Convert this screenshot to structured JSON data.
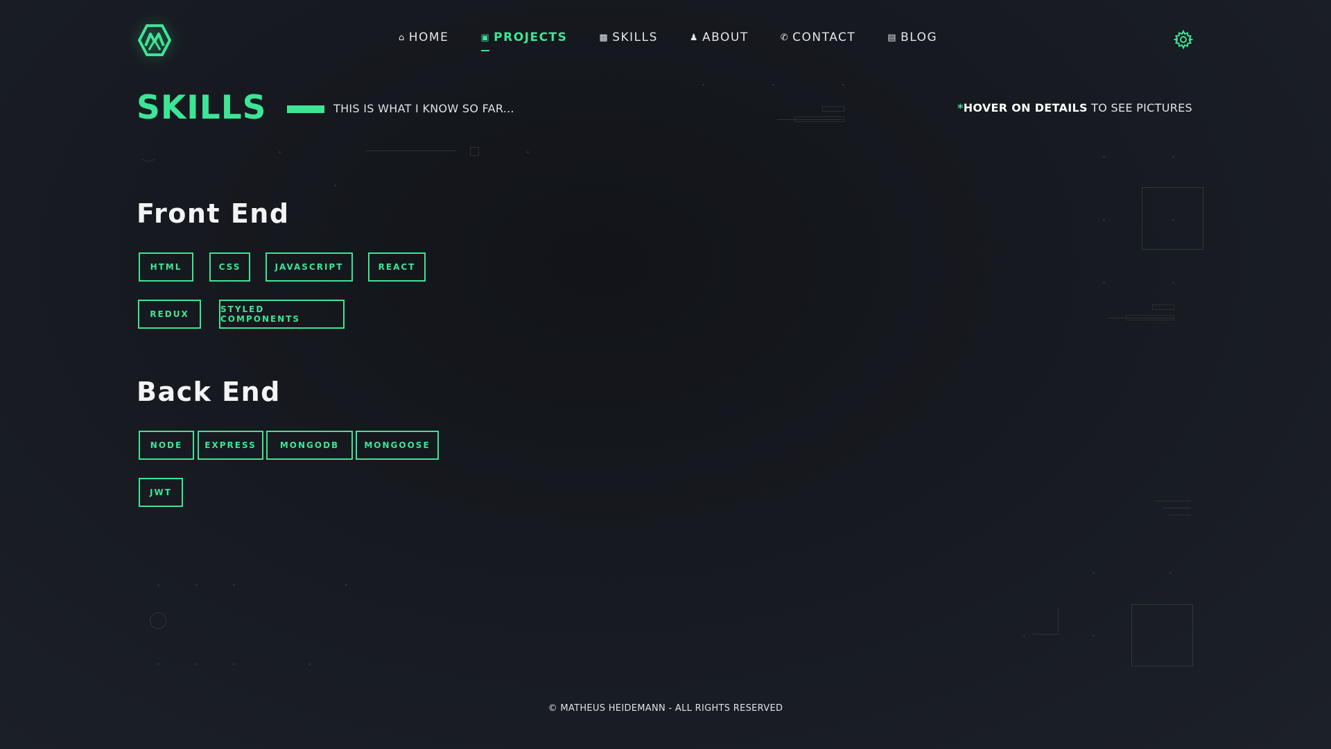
{
  "header": {
    "logo_icon": "hexagon-m-logo-icon",
    "nav": [
      {
        "label": "HOME",
        "icon": "home-icon",
        "active": false
      },
      {
        "label": "PROJECTS",
        "icon": "folder-icon",
        "active": true
      },
      {
        "label": "SKILLS",
        "icon": "chart-icon",
        "active": false
      },
      {
        "label": "ABOUT",
        "icon": "user-icon",
        "active": false
      },
      {
        "label": "CONTACT",
        "icon": "phone-icon",
        "active": false
      },
      {
        "label": "BLOG",
        "icon": "laptop-icon",
        "active": false
      }
    ],
    "settings_icon": "gear-icon"
  },
  "page": {
    "title": "SKILLS",
    "subtitle": "THIS IS WHAT I KNOW SO FAR...",
    "hint": {
      "star": "*",
      "strong": "HOVER ON DETAILS",
      "rest": " TO SEE PICTURES"
    }
  },
  "sections": {
    "frontend": {
      "title": "Front End",
      "tags": [
        "HTML",
        "CSS",
        "JAVASCRIPT",
        "REACT",
        "REDUX",
        "STYLED COMPONENTS"
      ]
    },
    "backend": {
      "title": "Back End",
      "tags": [
        "NODE",
        "EXPRESS",
        "MONGODB",
        "MONGOOSE",
        "JWT"
      ]
    }
  },
  "footer": {
    "text": "© MATHEUS HEIDEMANN - ALL RIGHTS RESERVED"
  },
  "colors": {
    "accent": "#3de596",
    "background": "#16191f",
    "text": "#e6e8ec"
  }
}
